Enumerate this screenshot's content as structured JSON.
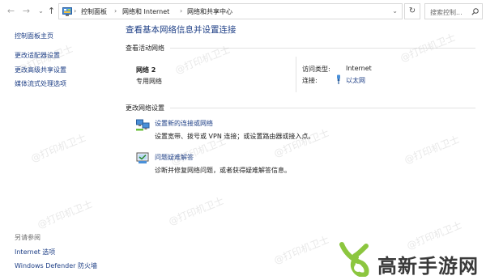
{
  "address_bar": {
    "breadcrumbs": [
      "控制面板",
      "网络和 Internet",
      "网络和共享中心"
    ],
    "search_placeholder": "搜索控制..."
  },
  "left_pane": {
    "links": [
      "控制面板主页",
      "更改适配器设置",
      "更改高级共享设置",
      "媒体流式处理选项"
    ],
    "see_also_heading": "另请参阅",
    "see_also_links": [
      "Internet 选项",
      "Windows Defender 防火墙"
    ]
  },
  "main": {
    "title": "查看基本网络信息并设置连接",
    "active_section": "查看活动网络",
    "network": {
      "name": "网络 2",
      "type": "专用网络",
      "access_label": "访问类型:",
      "access_value": "Internet",
      "connection_label": "连接:",
      "connection_value": "以太网"
    },
    "change_section": "更改网络设置",
    "tasks": [
      {
        "link": "设置新的连接或网络",
        "desc": "设置宽带、拨号或 VPN 连接；或设置路由器或接入点。",
        "icon": "network-setup-icon"
      },
      {
        "link": "问题疑难解答",
        "desc": "诊断并修复网络问题，或者获得疑难解答信息。",
        "icon": "troubleshoot-icon"
      }
    ]
  },
  "watermark_text": "@打印机卫士",
  "brand": {
    "logo_text": "高新手游网",
    "logo_color": "#8cc63f"
  },
  "colors": {
    "link": "#1e3f86",
    "text": "#1e1e1e",
    "muted": "#6d6d6d",
    "rule": "#e2e2e2"
  }
}
